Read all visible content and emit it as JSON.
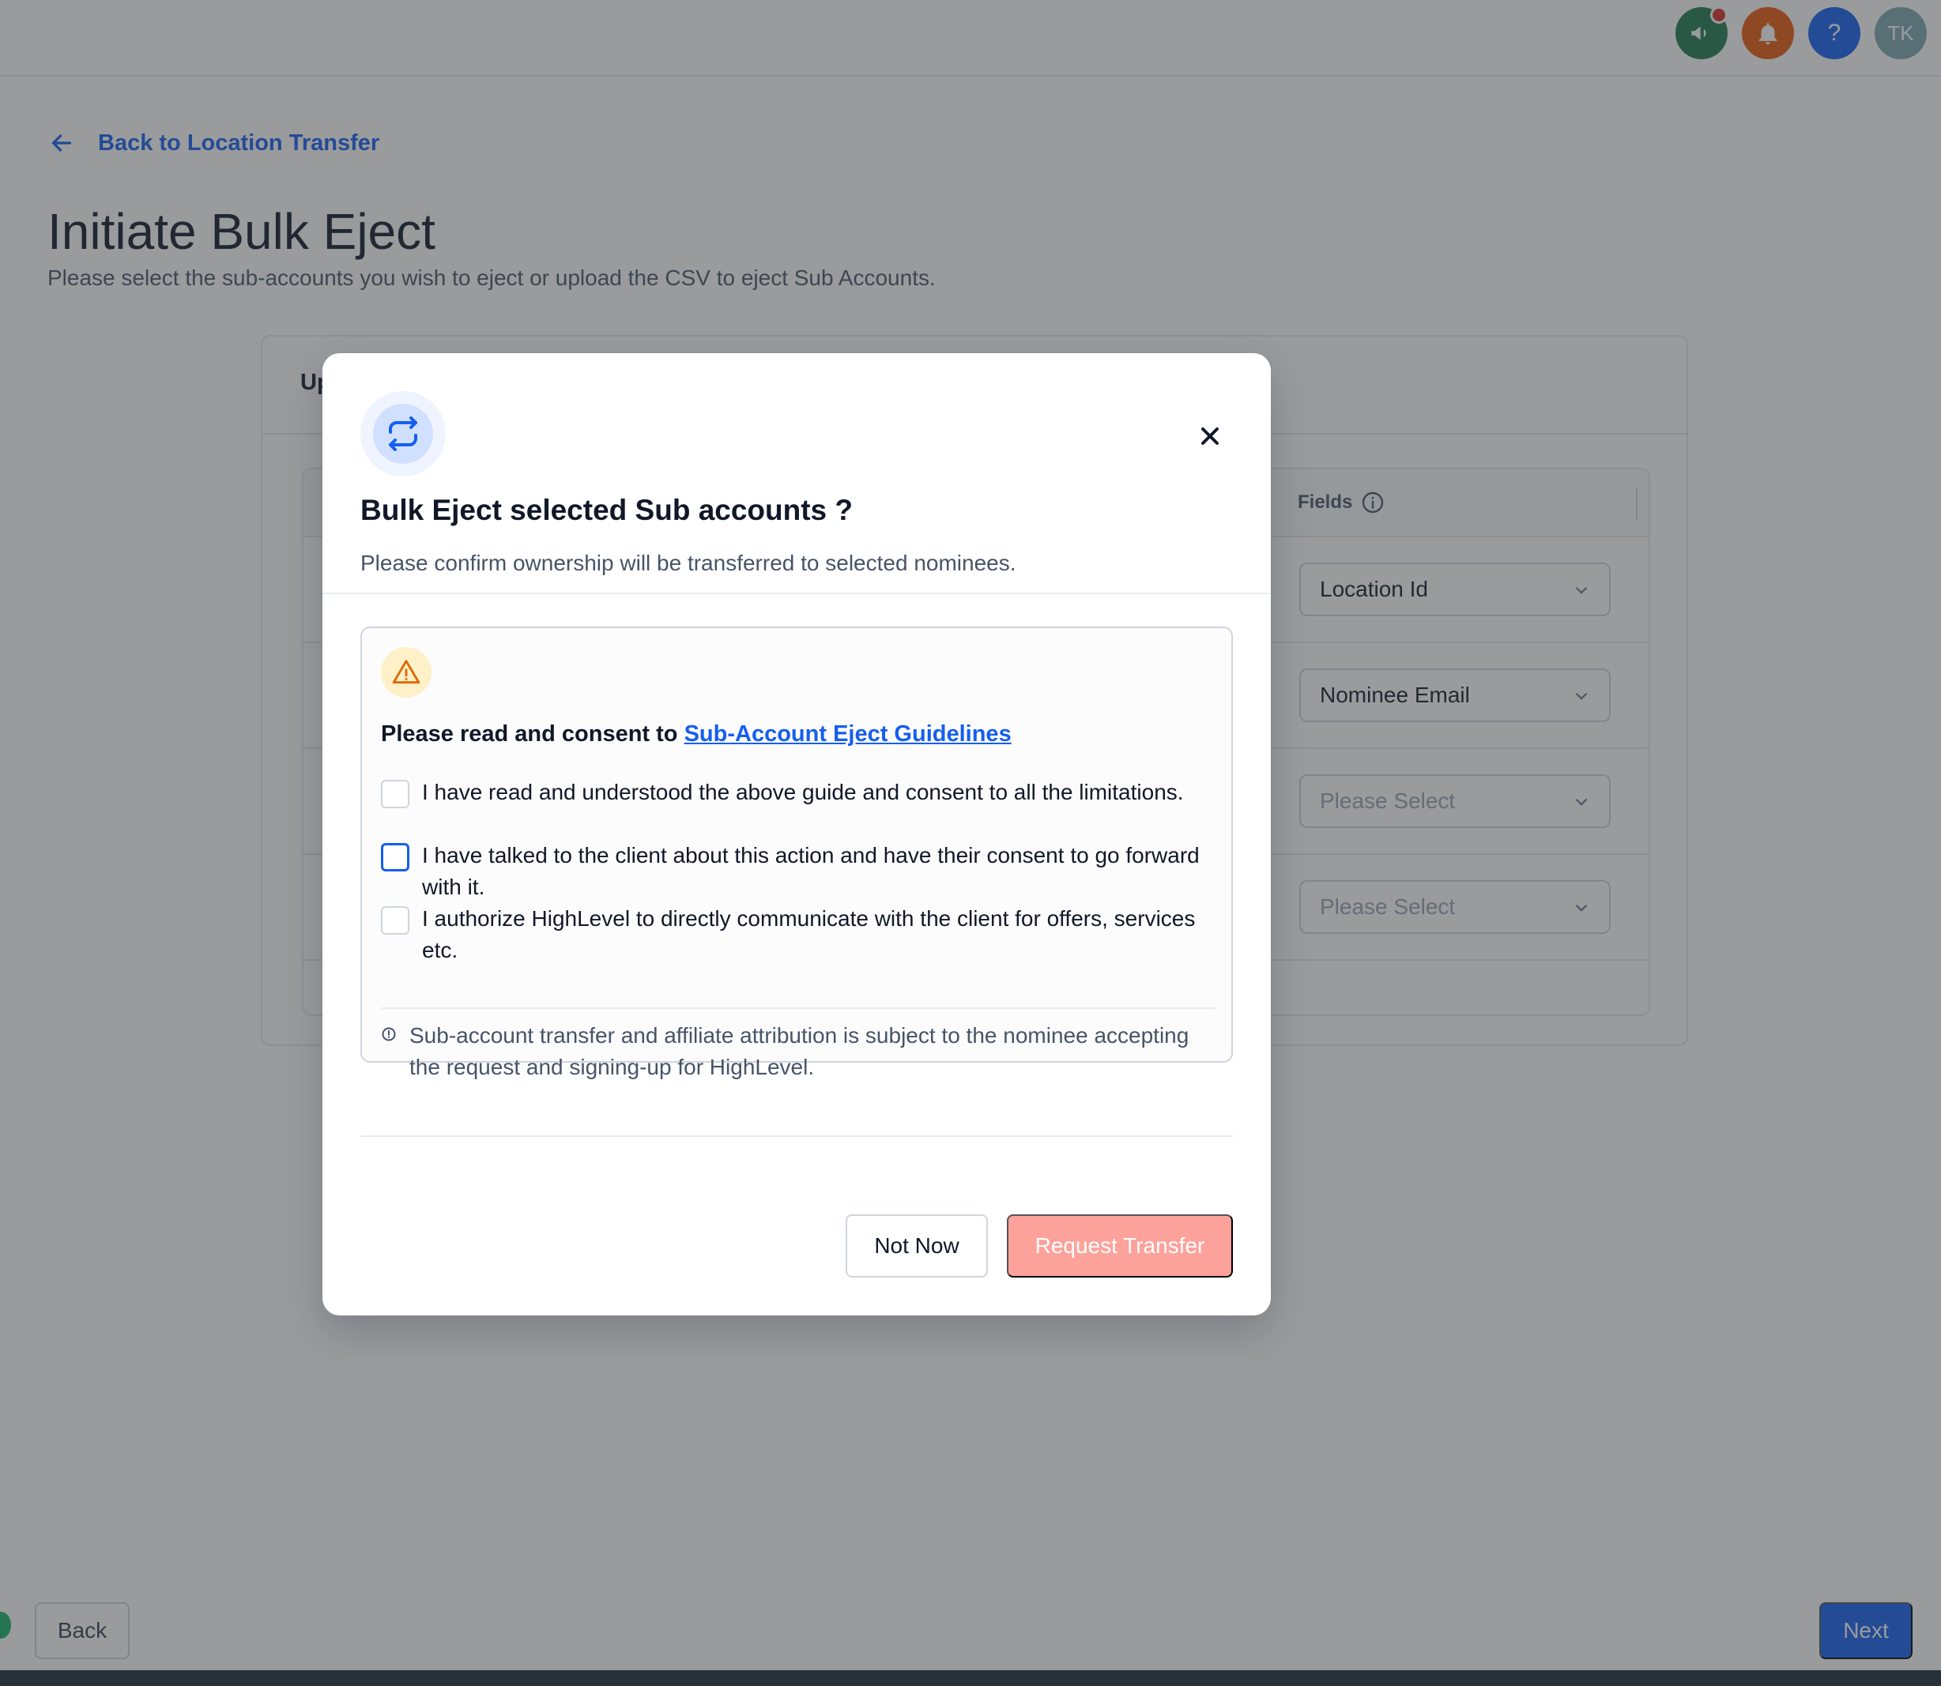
{
  "topbar": {
    "icons": [
      {
        "name": "announcement-icon",
        "color": "#1f7a4d",
        "badge": true
      },
      {
        "name": "bell-icon",
        "color": "#e8590c"
      },
      {
        "name": "help-icon",
        "color": "#155eef",
        "label": "?"
      },
      {
        "name": "avatar",
        "color": "#7fa7b0",
        "label": "TK"
      }
    ]
  },
  "page": {
    "back_link": "Back to Location Transfer",
    "title": "Initiate Bulk Eject",
    "subtitle": "Please select the sub-accounts you wish to eject or upload the CSV to eject Sub Accounts.",
    "tab_label": "Up",
    "fields_header": "Fields",
    "rows": [
      {
        "value": "Location Id",
        "placeholder": false
      },
      {
        "value": "Nominee Email",
        "placeholder": false
      },
      {
        "value": "Please Select",
        "placeholder": true
      },
      {
        "value": "Please Select",
        "placeholder": true
      }
    ]
  },
  "footer": {
    "back_label": "Back",
    "next_label": "Next"
  },
  "modal": {
    "title": "Bulk Eject selected Sub accounts ?",
    "subtitle": "Please confirm ownership will be transferred to selected nominees.",
    "consent_prefix": "Please read and consent to ",
    "consent_link": "Sub-Account Eject Guidelines",
    "checkboxes": [
      "I have read and understood the above guide and consent to all the limitations.",
      "I have talked to the client about this action and have their consent to go forward with it.",
      "I authorize HighLevel to directly communicate with the client for offers, services etc."
    ],
    "info_note": "Sub-account transfer and affiliate attribution is subject to the nominee accepting the request and signing-up for HighLevel.",
    "not_now_label": "Not Now",
    "request_label": "Request Transfer"
  }
}
